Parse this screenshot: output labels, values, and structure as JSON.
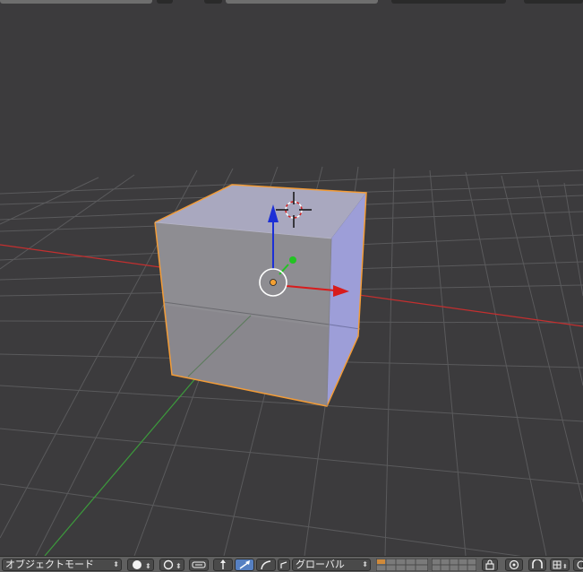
{
  "header": {
    "mode_label": "オブジェクトモード",
    "orientation_label": "グローバル"
  },
  "icons": {
    "viewport_shading": "solid-sphere-icon",
    "pivot_point": "pivot-icon",
    "manipulator_toggle": "manipulator-icon",
    "translate": "translate-arrow-icon",
    "rotate": "rotate-arc-icon",
    "scale": "scale-icon",
    "layers": "layers-grid-icon",
    "lock_camera": "lock-icon",
    "proportional_edit": "proportional-edit-icon",
    "snap": "magnet-icon",
    "snap_target": "snap-target-icon"
  },
  "colors": {
    "viewport_bg": "#3c3b3d",
    "grid_line": "#5a5a5c",
    "x_axis": "#c42f2f",
    "y_axis": "#3c9a3c",
    "z_axis": "#1c2fd6",
    "selection_outline": "#f39c37",
    "cube_top": "#a9a8bf",
    "cube_right": "#9d9ed8",
    "cube_front": "#8e8d92",
    "header_bg": "#606060",
    "active_button": "#5680c2"
  }
}
